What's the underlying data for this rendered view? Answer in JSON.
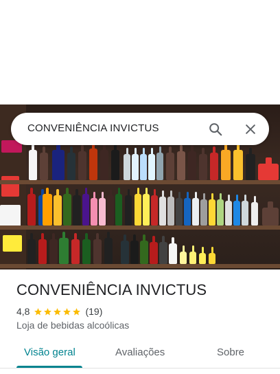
{
  "search": {
    "query": "CONVENIÊNCIA INVICTUS",
    "search_icon": "search-icon",
    "close_icon": "close-icon"
  },
  "photo": {
    "description_icon": "store-photo"
  },
  "place": {
    "title": "CONVENIÊNCIA INVICTUS",
    "rating": "4,8",
    "stars": 5,
    "review_count": "(19)",
    "category": "Loja de bebidas alcoólicas"
  },
  "tabs": [
    {
      "label": "Visão geral",
      "active": true
    },
    {
      "label": "Avaliações",
      "active": false
    },
    {
      "label": "Sobre",
      "active": false
    }
  ],
  "colors": {
    "accent": "#00838f",
    "star": "#fbbc04"
  }
}
